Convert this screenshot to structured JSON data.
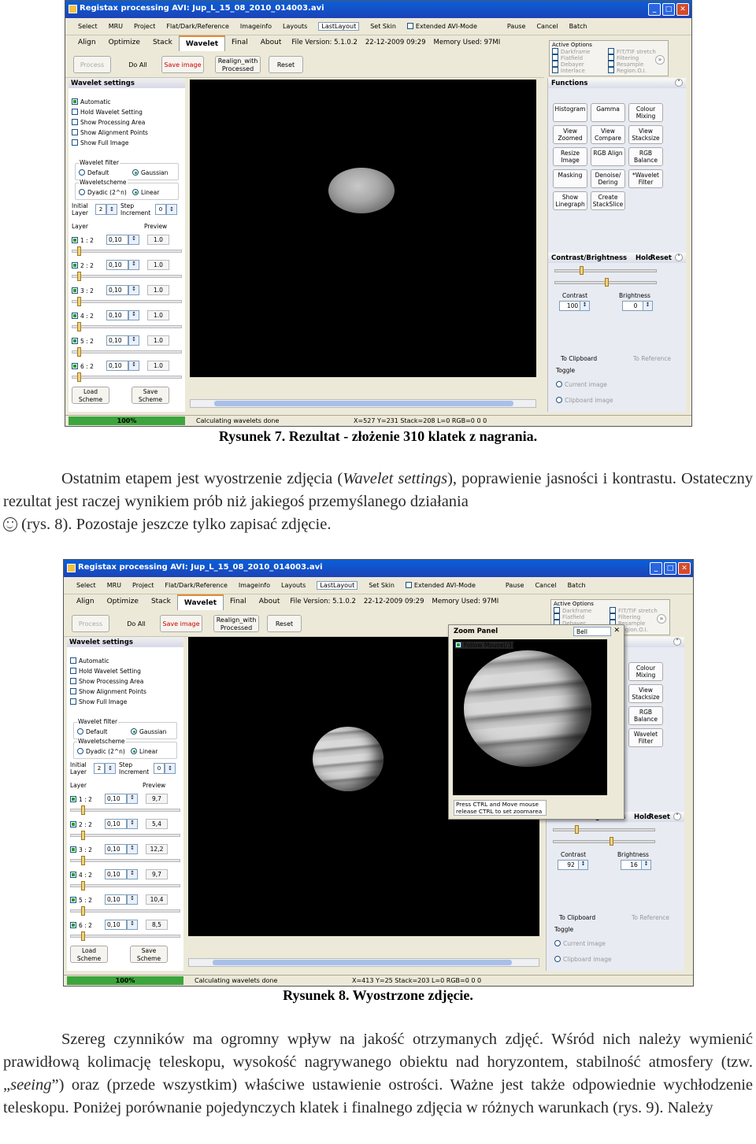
{
  "figure1": {
    "window_title": "Registax processing AVI: Jup_L_15_08_2010_014003.avi",
    "menu": [
      "Select",
      "MRU",
      "Project",
      "Flat/Dark/Reference",
      "Imageinfo",
      "Layouts",
      "LastLayout",
      "Set Skin",
      "Extended AVI-Mode",
      "Pause",
      "Cancel",
      "Batch"
    ],
    "tabs": [
      "Align",
      "Optimize",
      "Stack",
      "Wavelet",
      "Final",
      "About"
    ],
    "file_version": "File Version: 5.1.0.2",
    "date": "22-12-2009 09:29",
    "memory": "Memory Used: 97MI",
    "toolbar": [
      "Process",
      "Do All",
      "Save image",
      "Realign_with Processed",
      "Reset"
    ],
    "active_options": {
      "title": "Active Options",
      "items": [
        "Darkframe",
        "Flatfield",
        "Debayer",
        "Interlace",
        "FIT/TIF stretch",
        "Filtering",
        "Resample",
        "Region.O.I."
      ]
    },
    "wavelet": {
      "title": "Wavelet settings",
      "checks": [
        "Automatic",
        "Hold Wavelet Setting",
        "Show Processing Area",
        "Show Alignment Points",
        "Show Full Image"
      ],
      "filter_label": "Wavelet filter",
      "filter_options": [
        "Default",
        "Gaussian"
      ],
      "scheme_label": "Waveletscheme",
      "scheme_options": [
        "Dyadic (2^n)",
        "Linear"
      ],
      "initial_layer_label": "Initial Layer",
      "initial_layer": "2",
      "step_label": "Step Increment",
      "step": "0",
      "layer_label": "Layer",
      "preview_label": "Preview",
      "layers": [
        {
          "name": "1 : 2",
          "value": "0,10",
          "preview": "1.0",
          "slider": 0.05
        },
        {
          "name": "2 : 2",
          "value": "0,10",
          "preview": "1.0",
          "slider": 0.05
        },
        {
          "name": "3 : 2",
          "value": "0,10",
          "preview": "1.0",
          "slider": 0.05
        },
        {
          "name": "4 : 2",
          "value": "0,10",
          "preview": "1.0",
          "slider": 0.05
        },
        {
          "name": "5 : 2",
          "value": "0,10",
          "preview": "1.0",
          "slider": 0.05
        },
        {
          "name": "6 : 2",
          "value": "0,10",
          "preview": "1.0",
          "slider": 0.05
        }
      ],
      "load_scheme": "Load Scheme",
      "save_scheme": "Save Scheme"
    },
    "functions": {
      "title": "Functions",
      "buttons": [
        "Histogram",
        "Gamma",
        "Colour Mixing",
        "View Zoomed",
        "View Compare",
        "View Stacksize",
        "Resize Image",
        "RGB Align",
        "RGB Balance",
        "Masking",
        "Denoise/ Dering",
        "*Wavelet Filter",
        "Show Linegraph",
        "Create StackSlice"
      ]
    },
    "contrast": {
      "title": "Contrast/Brightness",
      "hold": "Hold",
      "reset": "Reset",
      "contrast_label": "Contrast",
      "contrast_value": "100",
      "brightness_label": "Brightness",
      "brightness_value": "0"
    },
    "clipboard": {
      "to_clipboard": "To Clipboard",
      "reference": "To Reference",
      "toggle": "Toggle",
      "current": "Current image",
      "clip": "Clipboard image"
    },
    "status": {
      "progress": "100%",
      "message": "Calculating wavelets done",
      "coords": "X=527 Y=231 Stack=208 L=0 RGB=0 0 0"
    }
  },
  "caption1": "Rysunek 7. Rezultat - złożenie 310 klatek z nagrania.",
  "paragraph1": {
    "part1": "Ostatnim etapem jest wyostrzenie zdjęcia (",
    "italic": "Wavelet settings",
    "part2": "), poprawienie jasności i kontrastu. Ostateczny rezultat jest raczej wynikiem prób niż jakiegoś przemyślanego działania",
    "part3": " (rys. 8). Pozostaje jeszcze tylko zapisać zdjęcie."
  },
  "figure2": {
    "window_title": "Registax processing AVI: Jup_L_15_08_2010_014003.avi",
    "layers": [
      {
        "name": "1 : 2",
        "value": "0,10",
        "preview": "9,7",
        "slider": 0.1
      },
      {
        "name": "2 : 2",
        "value": "0,10",
        "preview": "5,4",
        "slider": 0.1
      },
      {
        "name": "3 : 2",
        "value": "0,10",
        "preview": "12,2",
        "slider": 0.1
      },
      {
        "name": "4 : 2",
        "value": "0,10",
        "preview": "9,7",
        "slider": 0.1
      },
      {
        "name": "5 : 2",
        "value": "0,10",
        "preview": "10,4",
        "slider": 0.1
      },
      {
        "name": "6 : 2",
        "value": "0,10",
        "preview": "8,5",
        "slider": 0.1
      }
    ],
    "functions_buttons": [
      "Colour Mixing",
      "View Stacksize",
      "RGB Balance",
      "Wavelet Filter"
    ],
    "zoom_panel": {
      "title": "Zoom Panel",
      "mode": "Bell",
      "checkbox": "Follow Mouse(/3)",
      "info": "Press CTRL and Move mouse release CTRL to set zoomarea"
    },
    "contrast_value": "92",
    "brightness_value": "16",
    "status": {
      "progress": "100%",
      "message": "Calculating wavelets done",
      "coords": "X=413 Y=25 Stack=203 L=0 RGB=0 0 0"
    }
  },
  "caption2": "Rysunek 8. Wyostrzone zdjęcie.",
  "paragraph2": {
    "part1": "Szereg czynników ma ogromny wpływ na jakość otrzymanych zdjęć. Wśród nich należy wymienić prawidłową kolimację teleskopu, wysokość nagrywanego obiektu nad horyzontem, stabilność atmosfery (tzw. „",
    "italic": "seeing",
    "part2": "”) oraz (przede wszystkim) właściwe ustawienie ostrości. Ważne jest także odpowiednie wychłodzenie teleskopu. Poniżej porównanie pojedynczych klatek i finalnego zdjęcia w różnych warunkach (rys. 9). Należy"
  }
}
